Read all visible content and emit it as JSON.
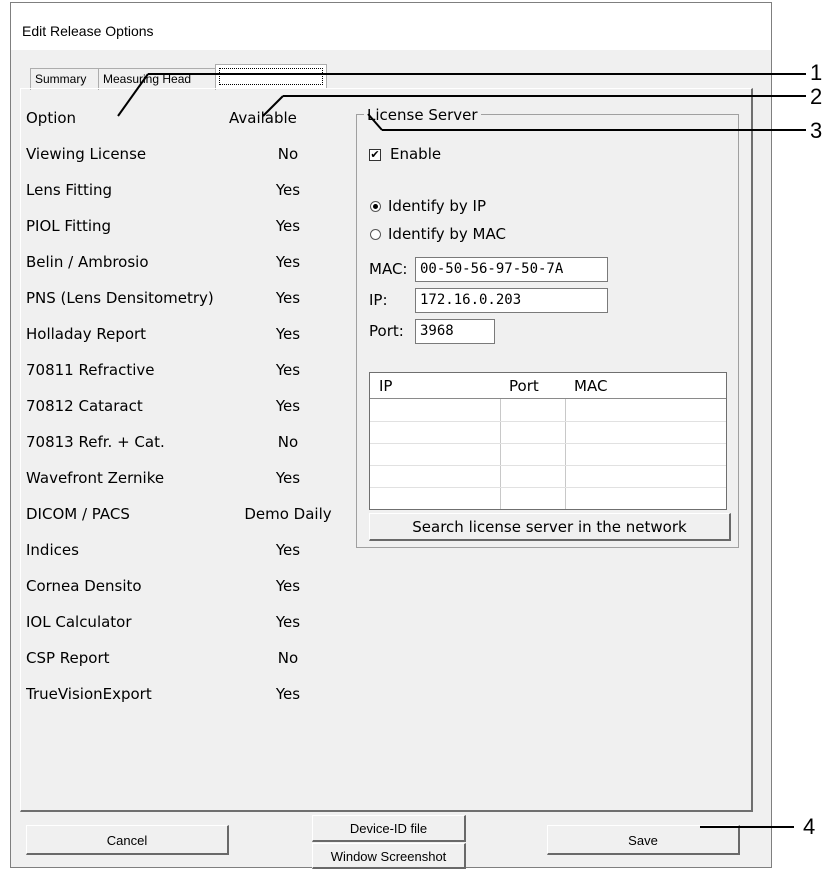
{
  "window": {
    "title": "Edit Release Options"
  },
  "tabs": [
    {
      "label": "Summary"
    },
    {
      "label": "Measuring Head"
    },
    {
      "label": ""
    }
  ],
  "options": {
    "header_option": "Option",
    "header_available": "Available",
    "rows": [
      {
        "name": "Viewing License",
        "value": "No"
      },
      {
        "name": "Lens Fitting",
        "value": "Yes"
      },
      {
        "name": "PIOL Fitting",
        "value": "Yes"
      },
      {
        "name": "Belin / Ambrosio",
        "value": "Yes"
      },
      {
        "name": "PNS (Lens Densitometry)",
        "value": "Yes"
      },
      {
        "name": "Holladay Report",
        "value": "Yes"
      },
      {
        "name": "70811 Refractive",
        "value": "Yes"
      },
      {
        "name": "70812 Cataract",
        "value": "Yes"
      },
      {
        "name": "70813  Refr. + Cat.",
        "value": "No"
      },
      {
        "name": "Wavefront Zernike",
        "value": "Yes"
      },
      {
        "name": "DICOM / PACS",
        "value": "Demo Daily"
      },
      {
        "name": "Indices",
        "value": "Yes"
      },
      {
        "name": "Cornea Densito",
        "value": "Yes"
      },
      {
        "name": "IOL Calculator",
        "value": "Yes"
      },
      {
        "name": "CSP Report",
        "value": "No"
      },
      {
        "name": "TrueVisionExport",
        "value": "Yes"
      }
    ]
  },
  "license_server": {
    "title": "License Server",
    "enable_label": "Enable",
    "enable_checked": true,
    "identify_ip_label": "Identify by IP",
    "identify_mac_label": "Identify by MAC",
    "identify_selected": "ip",
    "mac_label": "MAC:",
    "mac_value": "00-50-56-97-50-7A",
    "ip_label": "IP:",
    "ip_value": "172.16.0.203",
    "port_label": "Port:",
    "port_value": "3968",
    "table_headers": {
      "ip": "IP",
      "port": "Port",
      "mac": "MAC"
    },
    "search_button": "Search license server in the network"
  },
  "buttons": {
    "cancel": "Cancel",
    "device_id": "Device-ID file",
    "window_screenshot": "Window Screenshot",
    "save": "Save"
  },
  "callouts": [
    "1",
    "2",
    "3",
    "4"
  ]
}
